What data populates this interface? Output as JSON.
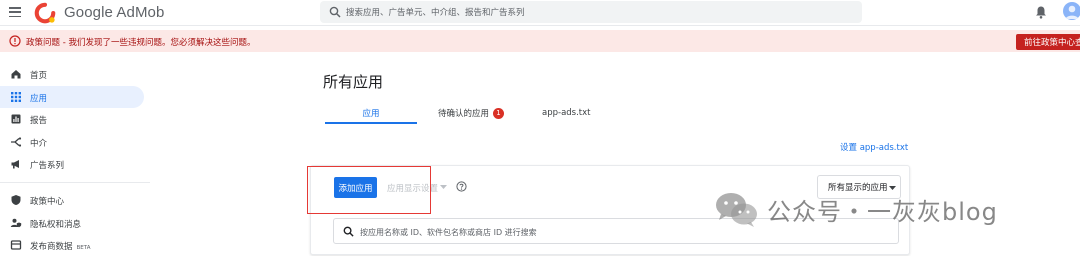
{
  "header": {
    "brand": "Google AdMob",
    "search_placeholder": "搜索应用、广告单元、中介组、报告和广告系列"
  },
  "alert": {
    "message": "政策问题 - 我们发现了一些违规问题。您必须解决这些问题。",
    "action_label": "前往政策中心查看"
  },
  "sidebar": {
    "items": [
      {
        "label": "首页",
        "icon": "home-icon"
      },
      {
        "label": "应用",
        "icon": "apps-grid-icon",
        "active": true
      },
      {
        "label": "报告",
        "icon": "reports-icon"
      },
      {
        "label": "中介",
        "icon": "mediation-icon"
      },
      {
        "label": "广告系列",
        "icon": "campaigns-icon"
      },
      {
        "label": "政策中心",
        "icon": "shield-icon"
      },
      {
        "label": "隐私权和消息",
        "icon": "privacy-icon"
      },
      {
        "label": "发布商数据",
        "icon": "publisher-data-icon",
        "badge": "BETA"
      }
    ]
  },
  "main": {
    "title": "所有应用",
    "tabs": [
      {
        "label": "应用",
        "active": true
      },
      {
        "label": "待确认的应用",
        "badge": "1"
      },
      {
        "label": "app-ads.txt"
      }
    ],
    "setup_link": "设置 app-ads.txt",
    "add_app_button": "添加应用",
    "display_settings": "应用显示设置",
    "filter_button": "所有显示的应用",
    "search_placeholder": "按应用名称或 ID、软件包名称或商店 ID 进行搜索"
  },
  "watermark": {
    "text": "公众号・一灰灰blog"
  },
  "colors": {
    "accent": "#1a73e8",
    "alert_bg": "#fce8e6",
    "alert_button": "#c5221f",
    "highlight_box": "#e53935"
  }
}
